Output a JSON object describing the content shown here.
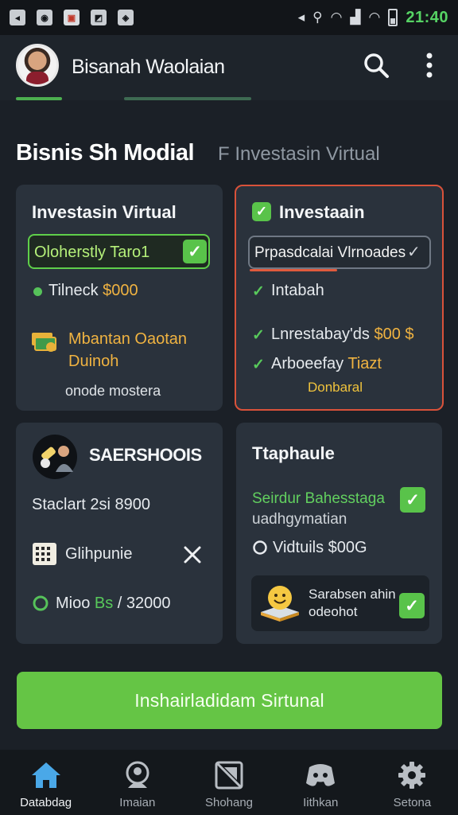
{
  "status_bar": {
    "time": "21:40",
    "left_icons": [
      "signal-icon",
      "circle-app-icon",
      "flag-app-icon",
      "image-app-icon",
      "photo-app-icon"
    ],
    "right_icons": [
      "mute-icon",
      "search-status-icon",
      "wifi-icon",
      "signal-bars-icon",
      "wifi-icon-2",
      "battery-icon"
    ]
  },
  "app_bar": {
    "title": "Bisanah Waolaian"
  },
  "section": {
    "title": "Bisnis Sh Modial",
    "subtitle": "F Investasin Virtual"
  },
  "card1": {
    "title": "Investasin Virtual",
    "pill": "Oloherstly Taro1",
    "row1_text": "Tilneck ",
    "row1_value": "$000",
    "row2_line1": "Mbantan Oaotan",
    "row2_line2": "Duinoh",
    "footer": "onode mostera"
  },
  "card2": {
    "title": "Investaain",
    "dropdown": "Prpasdcalai Vlrnoades",
    "item1": "Intabah",
    "item2_text": "Lnrestabay'ds ",
    "item2_value": "$00 $",
    "item3_text": "Arboeefay ",
    "item3_value": "Tiazt",
    "item3_sub": "Donbaral"
  },
  "card3": {
    "title": "SAERSHOOIS",
    "line1": "Staclart 2si 8900",
    "line2": "Glihpunie",
    "line3_a": "Mioo ",
    "line3_b": "Bs",
    "line3_c": " / 32000"
  },
  "card4": {
    "title": "Ttaphaule",
    "line1": "Seirdur Bahesstaga",
    "line2": "uadhgymatian",
    "line3": "Vidtuils $00G",
    "inner_line1": "Sarabsen ahin",
    "inner_line2": "odeohot"
  },
  "cta": {
    "label": "Inshairladidam Sirtunal"
  },
  "bottom_nav": [
    {
      "label": "Databdag",
      "icon": "home-icon",
      "active": true
    },
    {
      "label": "Imaian",
      "icon": "chat-icon",
      "active": false
    },
    {
      "label": "Shohang",
      "icon": "shopping-icon",
      "active": false
    },
    {
      "label": "Iithkan",
      "icon": "discord-icon",
      "active": false
    },
    {
      "label": "Setona",
      "icon": "gear-icon",
      "active": false
    }
  ],
  "colors": {
    "accent_green": "#65c545",
    "card_bg": "#2a323c",
    "alert_border": "#d9523a",
    "highlight_orange": "#f0b341"
  }
}
